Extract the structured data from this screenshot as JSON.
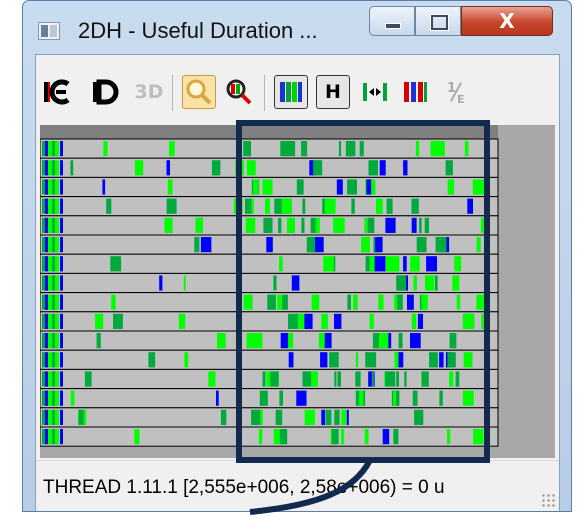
{
  "window": {
    "title": "2DH - Useful Duration ...",
    "minimize_label": "",
    "maximize_label": "",
    "close_label": "X"
  },
  "toolbar": {
    "buttons": [
      {
        "name": "ce-icon",
        "label": "CE"
      },
      {
        "name": "d-icon",
        "label": "D"
      },
      {
        "name": "3d-icon",
        "label": "3D"
      },
      {
        "name": "zoom-icon",
        "label": ""
      },
      {
        "name": "color-zoom-icon",
        "label": ""
      },
      {
        "name": "color-bars-icon",
        "label": ""
      },
      {
        "name": "h-button",
        "label": "H"
      },
      {
        "name": "fit-arrows-icon",
        "label": ""
      },
      {
        "name": "red-bars-icon",
        "label": ""
      },
      {
        "name": "fraction-icon",
        "label": ""
      }
    ]
  },
  "status": {
    "text": "THREAD 1.11.1  [2,555e+006, 2,58e+006)  = 0 u"
  },
  "colors": {
    "gray": "#c0c0c0",
    "green": "#00ff00",
    "dark_green": "#00aa3c",
    "blue": "#0000ff",
    "highlight": "#132a4e"
  }
}
